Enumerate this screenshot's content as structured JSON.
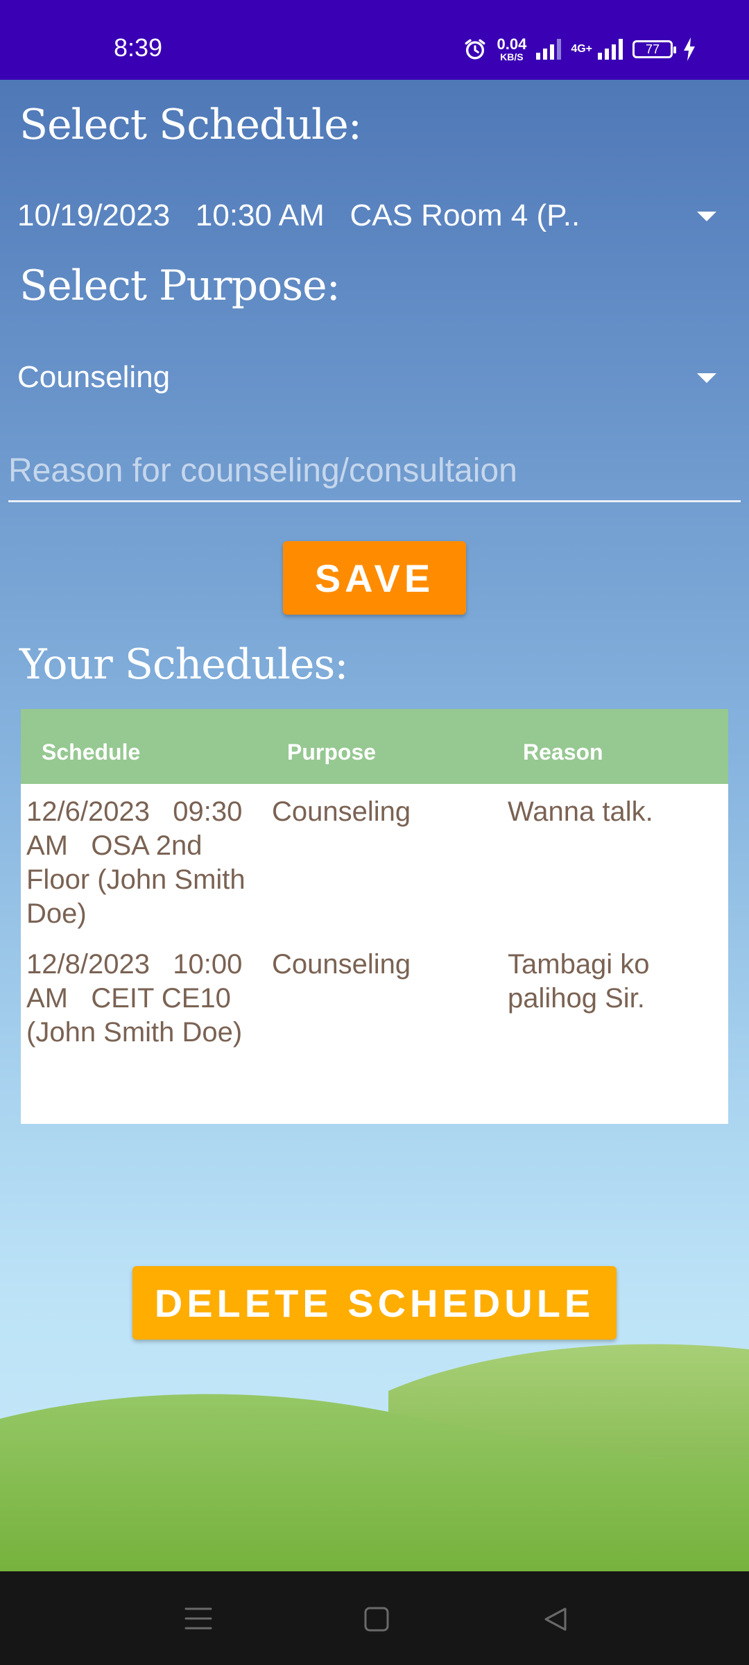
{
  "status_bar": {
    "time": "8:39",
    "net_speed_value": "0.04",
    "net_speed_unit": "KB/S",
    "network": "4G+",
    "battery": "77"
  },
  "form": {
    "schedule_label": "Select Schedule:",
    "schedule_selected": "10/19/2023   10:30 AM   CAS Room 4 (P..",
    "purpose_label": "Select Purpose:",
    "purpose_selected": "Counseling",
    "reason_placeholder": "Reason for counseling/consultaion",
    "save_label": "SAVE"
  },
  "schedules": {
    "title": "Your Schedules:",
    "headers": [
      "Schedule",
      "Purpose",
      "Reason"
    ],
    "rows": [
      {
        "schedule": "12/6/2023   09:30 AM   OSA 2nd Floor (John Smith Doe)",
        "purpose": "Counseling",
        "reason": "Wanna talk."
      },
      {
        "schedule": "12/8/2023   10:00 AM   CEIT CE10 (John Smith Doe)",
        "purpose": "Counseling",
        "reason": "Tambagi ko palihog Sir."
      }
    ]
  },
  "delete_label": "DELETE SCHEDULE",
  "colors": {
    "status_bar": "#3a00b4",
    "save_button": "#ff8c00",
    "delete_button": "#ffad00",
    "table_header": "#96c891",
    "table_text": "#7a6253"
  },
  "icons": {
    "alarm": "alarm-icon",
    "signal": "signal-icon",
    "charging": "charging-icon",
    "nav_menu": "menu-icon",
    "nav_home": "home-icon",
    "nav_back": "back-icon"
  }
}
